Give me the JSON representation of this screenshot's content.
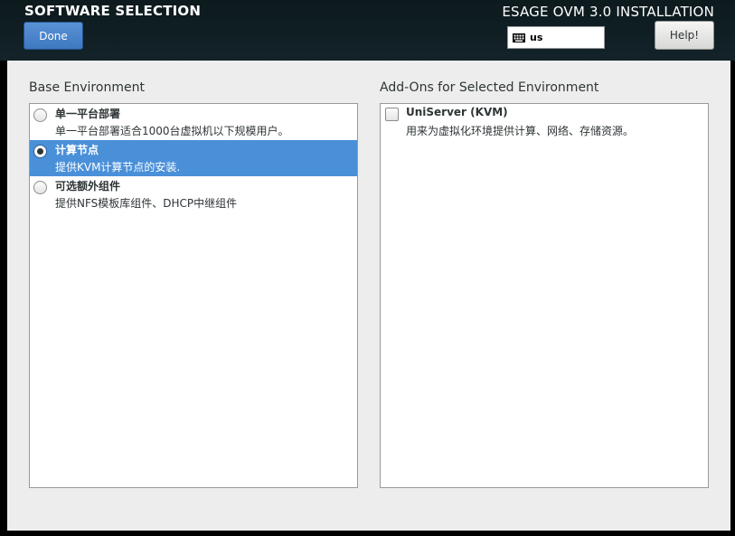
{
  "header": {
    "page_title": "SOFTWARE SELECTION",
    "done_label": "Done",
    "product_title": "ESAGE OVM 3.0 INSTALLATION",
    "keyboard_layout": "us",
    "help_label": "Help!"
  },
  "base_environment": {
    "label": "Base Environment",
    "items": [
      {
        "name": "单一平台部署",
        "description": "单一平台部署适合1000台虚拟机以下规模用户。",
        "selected": false
      },
      {
        "name": "计算节点",
        "description": "提供KVM计算节点的安装.",
        "selected": true
      },
      {
        "name": "可选额外组件",
        "description": "提供NFS模板库组件、DHCP中继组件",
        "selected": false
      }
    ]
  },
  "addons": {
    "label": "Add-Ons for Selected Environment",
    "items": [
      {
        "name": "UniServer (KVM)",
        "description": "用来为虚拟化环境提供计算、网络、存储资源。",
        "checked": false
      }
    ]
  },
  "colors": {
    "header_bg": "#122329",
    "selection_blue": "#4a90d9",
    "done_button_blue": "#4a86cf"
  },
  "icons": {
    "keyboard": "keyboard-icon"
  }
}
